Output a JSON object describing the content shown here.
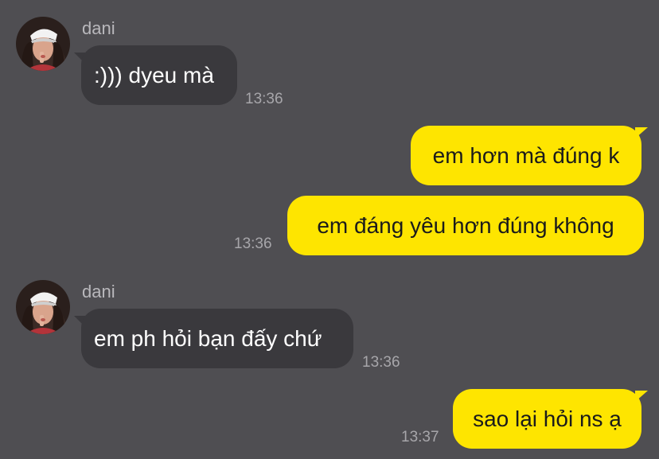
{
  "colors": {
    "background": "#4f4e52",
    "incoming_bubble": "#3a393d",
    "outgoing_bubble": "#fee500",
    "sender_name": "#b9b8bc",
    "timestamp": "#a7a6aa"
  },
  "messages": [
    {
      "direction": "incoming",
      "sender": "dani",
      "text": ":))) dyeu mà",
      "time": "13:36",
      "avatar_icon": "profile-photo-icon"
    },
    {
      "direction": "outgoing",
      "text": "em hơn mà đúng k",
      "time": ""
    },
    {
      "direction": "outgoing",
      "text": "em đáng yêu hơn đúng không",
      "time": "13:36"
    },
    {
      "direction": "incoming",
      "sender": "dani",
      "text": "em ph hỏi bạn đấy chứ",
      "time": "13:36",
      "avatar_icon": "profile-photo-icon"
    },
    {
      "direction": "outgoing",
      "text": "sao lại hỏi ns ạ",
      "time": "13:37"
    }
  ]
}
